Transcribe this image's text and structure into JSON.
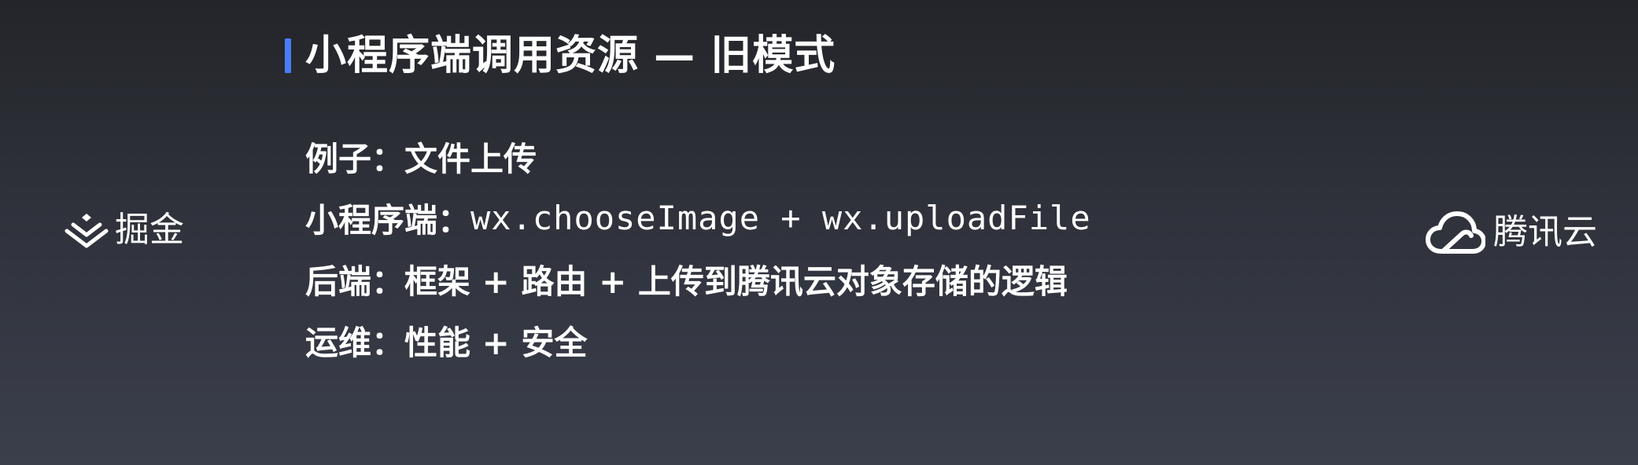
{
  "title": "小程序端调用资源 — 旧模式",
  "lines": [
    {
      "label": "例子：",
      "value": "文件上传"
    },
    {
      "label": "小程序端：",
      "value": "wx.chooseImage + wx.uploadFile"
    },
    {
      "label": "后端：",
      "value": "框架 + 路由 + 上传到腾讯云对象存储的逻辑"
    },
    {
      "label": "运维：",
      "value": "性能 + 安全"
    }
  ],
  "logos": {
    "left": {
      "text": "掘金",
      "icon": "juejin-icon"
    },
    "right": {
      "text": "腾讯云",
      "icon": "cloud-icon"
    }
  },
  "colors": {
    "accent": "#4a7cf5",
    "text": "#ffffff"
  }
}
